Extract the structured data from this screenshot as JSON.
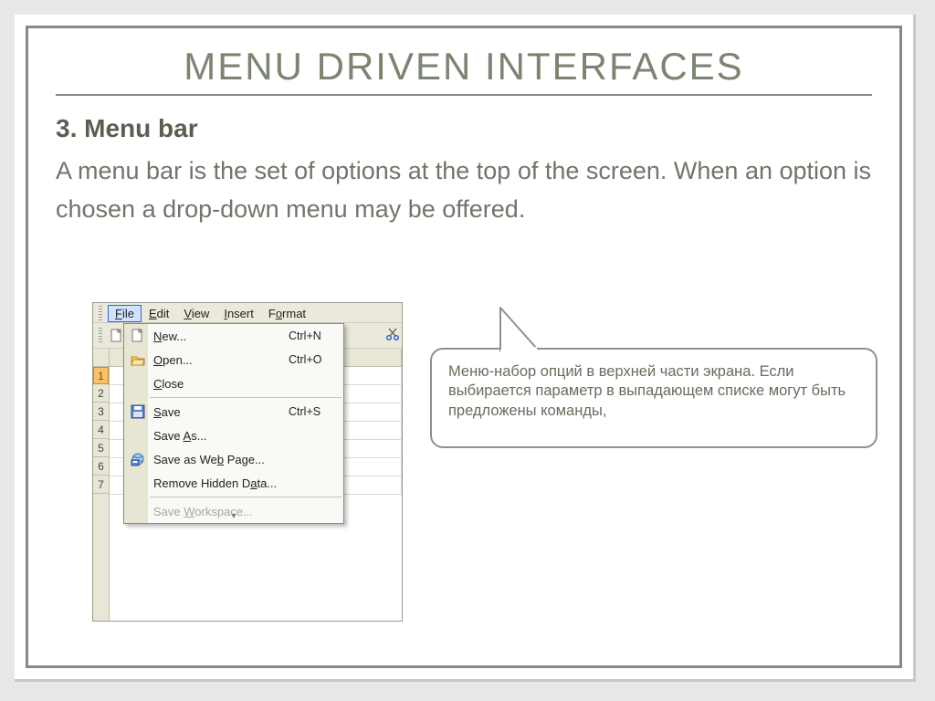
{
  "title": "MENU DRIVEN INTERFACES",
  "subtitle": "3. Menu bar",
  "body": "A menu bar is the set of options at the top of the screen. When an option is chosen a drop-down menu may be offered.",
  "callout_text": "Меню-набор опций в верхней части экрана. Если выбирается параметр в выпадающем списке могут быть предложены команды,",
  "menubar": {
    "file": "File",
    "edit": "Edit",
    "view": "View",
    "insert": "Insert",
    "format": "Format"
  },
  "rows": [
    "1",
    "2",
    "3",
    "4",
    "5",
    "6",
    "7"
  ],
  "dropdown": {
    "new": "New...",
    "new_short": "Ctrl+N",
    "open": "Open...",
    "open_short": "Ctrl+O",
    "close": "Close",
    "save": "Save",
    "save_short": "Ctrl+S",
    "saveas": "Save As...",
    "saveweb": "Save as Web Page...",
    "removehidden": "Remove Hidden Data...",
    "workspace": "Save Workspace..."
  }
}
